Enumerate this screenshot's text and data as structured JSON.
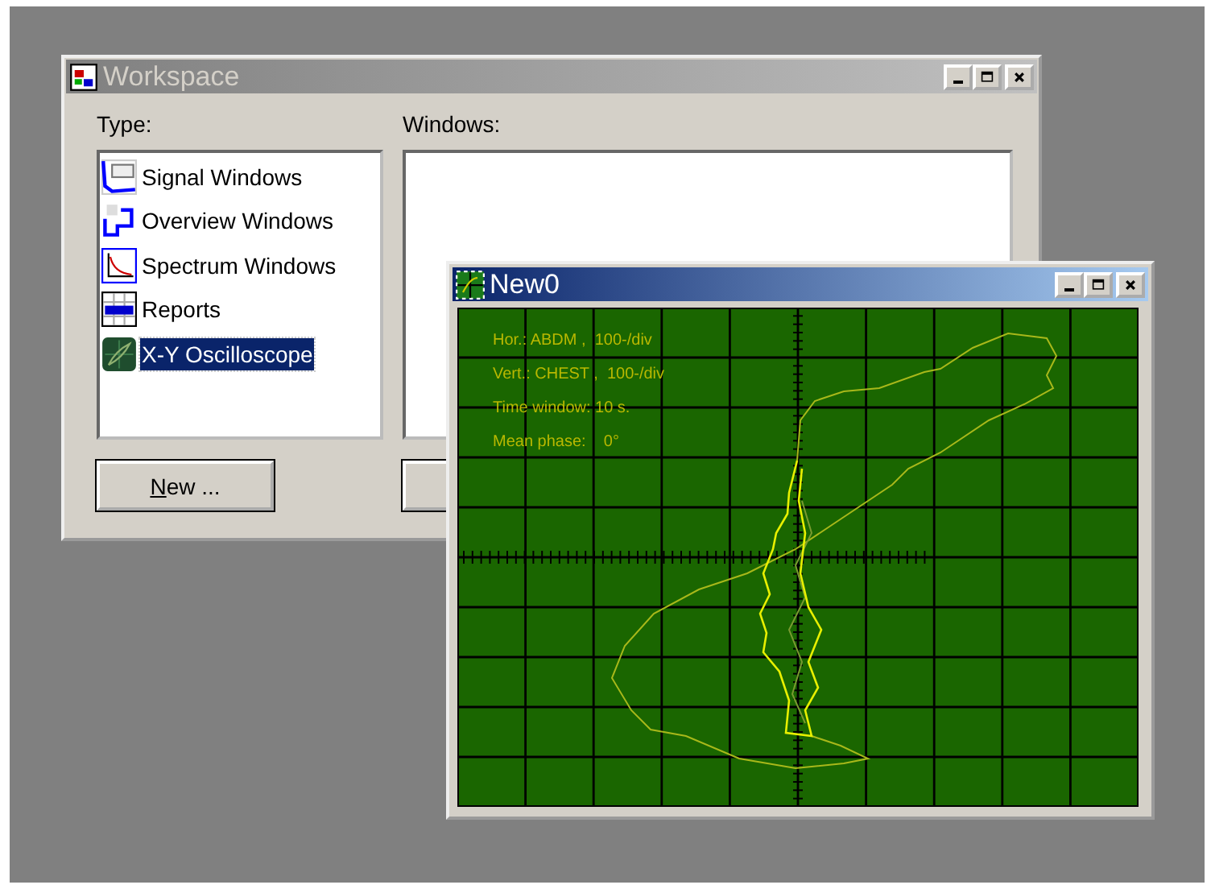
{
  "workspace": {
    "title": "Workspace",
    "active": false,
    "type_label": "Type:",
    "windows_label": "Windows:",
    "types": [
      {
        "label": "Signal Windows",
        "kind": "signal",
        "selected": false
      },
      {
        "label": "Overview Windows",
        "kind": "overview",
        "selected": false
      },
      {
        "label": "Spectrum Windows",
        "kind": "spectrum",
        "selected": false
      },
      {
        "label": "Reports",
        "kind": "report",
        "selected": false
      },
      {
        "label": "X-Y Oscilloscope",
        "kind": "scope",
        "selected": true
      }
    ],
    "new_button": "New ..."
  },
  "scope_window": {
    "title": "New0",
    "active": true,
    "info": [
      "Hor.: ABDM ,  100-/div",
      "Vert.: CHEST ,  100-/div",
      "Time window: 10 s.",
      "Mean phase:    0°"
    ]
  }
}
